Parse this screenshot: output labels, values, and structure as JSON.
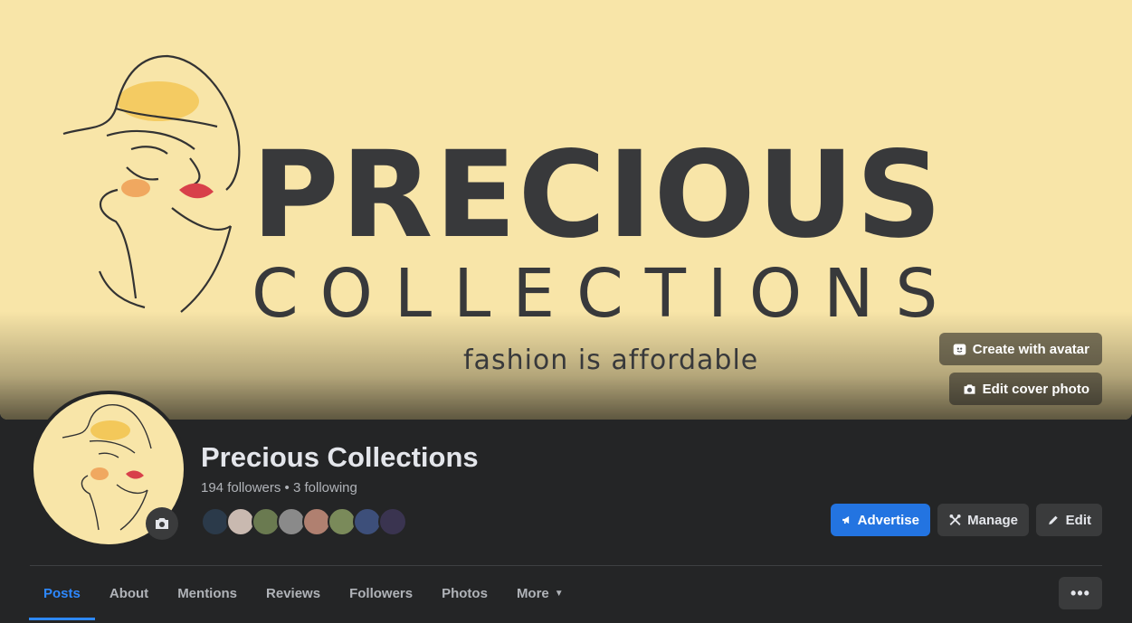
{
  "cover": {
    "brand_line_1": "PRECIOUS",
    "brand_line_2": "COLLECTIONS",
    "tagline": "fashion is affordable",
    "create_avatar_label": "Create with avatar",
    "edit_cover_label": "Edit cover photo"
  },
  "profile": {
    "name": "Precious Collections",
    "stats": "194 followers • 3 following",
    "follower_avatar_colors": [
      "#2b3a4a",
      "#c9b9b0",
      "#6a7a50",
      "#8a8a8a",
      "#b08070",
      "#7a8a5a",
      "#3d4f7a",
      "#3a3450"
    ]
  },
  "actions": {
    "advertise_label": "Advertise",
    "manage_label": "Manage",
    "edit_label": "Edit"
  },
  "tabs": {
    "posts": "Posts",
    "about": "About",
    "mentions": "Mentions",
    "reviews": "Reviews",
    "followers": "Followers",
    "photos": "Photos",
    "more": "More",
    "overflow": "•••"
  },
  "colors": {
    "cover_bg": "#f8e5a8",
    "accent": "#2d88ff",
    "advertise_bg": "#2374e1",
    "page_bg": "#242526"
  }
}
